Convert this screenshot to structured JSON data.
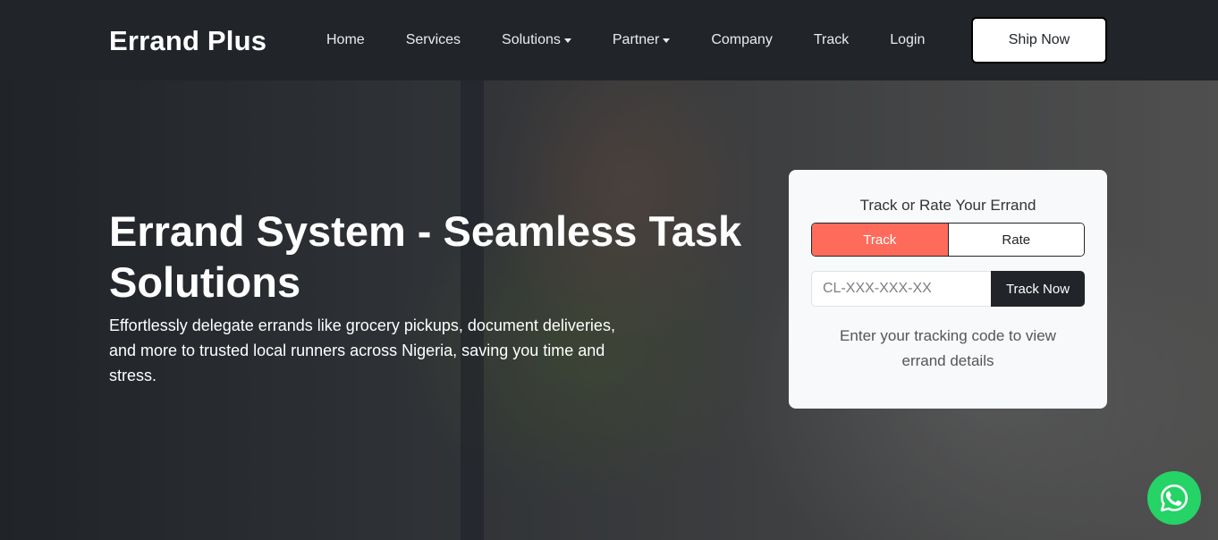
{
  "navbar": {
    "brand": "Errand Plus",
    "links": [
      {
        "label": "Home",
        "dropdown": false
      },
      {
        "label": "Services",
        "dropdown": false
      },
      {
        "label": "Solutions",
        "dropdown": true
      },
      {
        "label": "Partner",
        "dropdown": true
      },
      {
        "label": "Company",
        "dropdown": false
      },
      {
        "label": "Track",
        "dropdown": false
      },
      {
        "label": "Login",
        "dropdown": false
      }
    ],
    "cta_label": "Ship Now"
  },
  "hero": {
    "title": "Errand System - Seamless Task Solutions",
    "subtitle": "Effortlessly delegate errands like grocery pickups, document deliveries, and more to trusted local runners across Nigeria, saving you time and stress."
  },
  "track_card": {
    "title": "Track or Rate Your Errand",
    "tab_track": "Track",
    "tab_rate": "Rate",
    "active_tab": "Track",
    "input_placeholder": "CL-XXX-XXX-XX",
    "input_value": "",
    "button_label": "Track Now",
    "help_text": "Enter your tracking code to view errand details"
  },
  "colors": {
    "navbar_bg": "#212529",
    "accent": "#ff6b5b",
    "whatsapp": "#25d366"
  },
  "floating": {
    "icon": "whatsapp-icon"
  }
}
